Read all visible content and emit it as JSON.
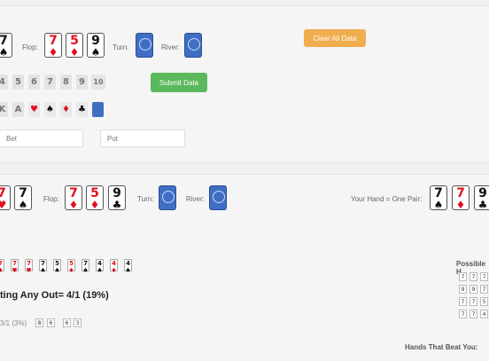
{
  "top": {
    "hole_card": {
      "rank": "7",
      "suit": "♠",
      "color": "black"
    },
    "flop_label": "Flop:",
    "flop": [
      {
        "rank": "7",
        "suit": "♦",
        "color": "red"
      },
      {
        "rank": "5",
        "suit": "♦",
        "color": "red"
      },
      {
        "rank": "9",
        "suit": "♠",
        "color": "black"
      }
    ],
    "turn_label": "Turn:",
    "river_label": "River:",
    "clear_button": "Clear All Data",
    "submit_button": "Submit Data",
    "rank_keys": [
      "4",
      "5",
      "6",
      "7",
      "8",
      "9",
      "10"
    ],
    "face_keys": [
      "K",
      "A"
    ],
    "suit_keys": [
      {
        "glyph": "♥",
        "color": "red"
      },
      {
        "glyph": "♠",
        "color": "black"
      },
      {
        "glyph": "♦",
        "color": "red"
      },
      {
        "glyph": "♣",
        "color": "black"
      }
    ],
    "bet_placeholder": "Bet",
    "pot_placeholder": "Pot"
  },
  "bottom": {
    "hole_cards": [
      {
        "rank": "7",
        "suit": "♥",
        "color": "red"
      },
      {
        "rank": "7",
        "suit": "♠",
        "color": "black"
      }
    ],
    "flop_label": "Flop:",
    "flop": [
      {
        "rank": "7",
        "suit": "♦",
        "color": "red"
      },
      {
        "rank": "5",
        "suit": "♦",
        "color": "red"
      },
      {
        "rank": "9",
        "suit": "♣",
        "color": "black"
      }
    ],
    "turn_label": "Turn:",
    "river_label": "River:",
    "your_hand_label": "Your Hand = One Pair:",
    "your_hand_cards": [
      {
        "rank": "7",
        "suit": "♠",
        "color": "black"
      },
      {
        "rank": "7",
        "suit": "♦",
        "color": "red"
      },
      {
        "rank": "9",
        "suit": "♣",
        "color": "black"
      }
    ],
    "outs": [
      {
        "rank": "7",
        "suit": "♦",
        "color": "red"
      },
      {
        "rank": "7",
        "suit": "♥",
        "color": "red"
      },
      {
        "rank": "7",
        "suit": "♥",
        "color": "red"
      },
      {
        "rank": "7",
        "suit": "♠",
        "color": "black"
      },
      {
        "rank": "5",
        "suit": "♠",
        "color": "black"
      },
      {
        "rank": "5",
        "suit": "♦",
        "color": "red"
      },
      {
        "rank": "7",
        "suit": "♠",
        "color": "black"
      },
      {
        "rank": "4",
        "suit": "♠",
        "color": "black"
      },
      {
        "rank": "4",
        "suit": "♦",
        "color": "red"
      },
      {
        "rank": "4",
        "suit": "♠",
        "color": "black"
      }
    ],
    "any_out_text": "ting Any Out= 4/1 (19%)",
    "odds_text": "3/1 (3%)",
    "odds_cards": [
      "8",
      "6",
      "6",
      "3"
    ],
    "possible_label": "Possible H",
    "possible_grid": [
      [
        "7",
        "7",
        "7"
      ],
      [
        "9",
        "9",
        "7"
      ],
      [
        "7",
        "7",
        "5"
      ],
      [
        "7",
        "7",
        "4"
      ]
    ],
    "beat_label": "Hands That Beat You:"
  },
  "colors": {
    "accent_orange": "#f0ad4e",
    "accent_green": "#5cb85c",
    "card_back": "#3f6fc4",
    "suit_red": "#e0101f"
  }
}
